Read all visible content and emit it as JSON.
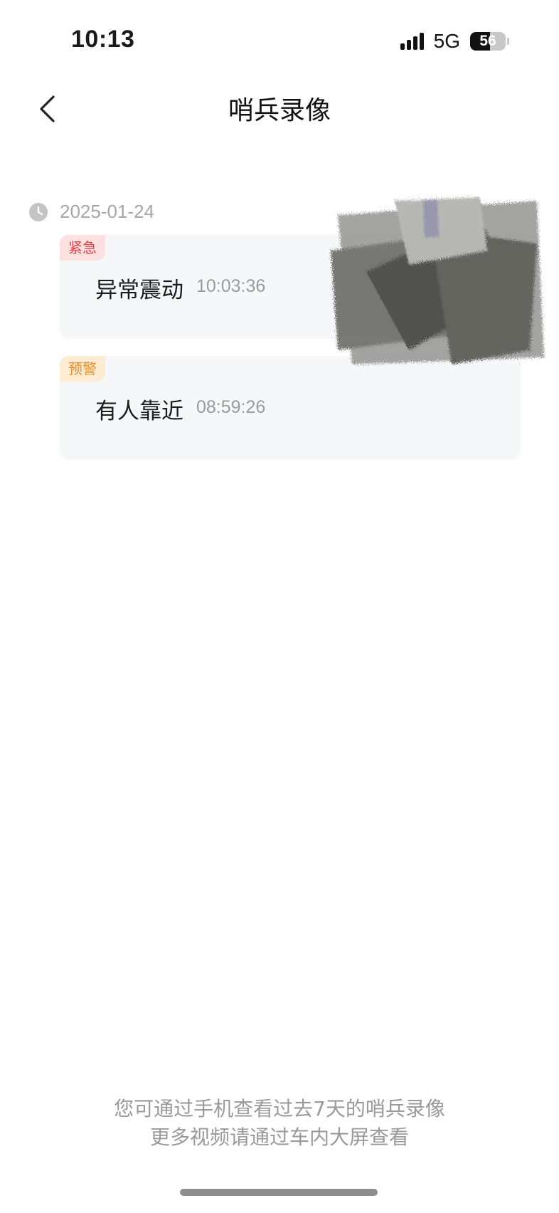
{
  "status_bar": {
    "time": "10:13",
    "network": "5G",
    "battery": "56",
    "battery_level": 0.56
  },
  "header": {
    "title": "哨兵录像",
    "back_icon": "chevron-left-icon"
  },
  "timeline": {
    "date": "2025-01-24",
    "date_icon": "clock-icon",
    "events": [
      {
        "badge": "紧急",
        "badge_color": "#e0454a",
        "badge_bg": "#fde0e0",
        "title": "异常震动",
        "time": "10:03:36"
      },
      {
        "badge": "预警",
        "badge_color": "#e8902a",
        "badge_bg": "#fdebd2",
        "title": "有人靠近",
        "time": "08:59:26"
      }
    ]
  },
  "footer": {
    "line1": "您可通过手机查看过去7天的哨兵录像",
    "line2": "更多视频请通过车内大屏查看"
  }
}
